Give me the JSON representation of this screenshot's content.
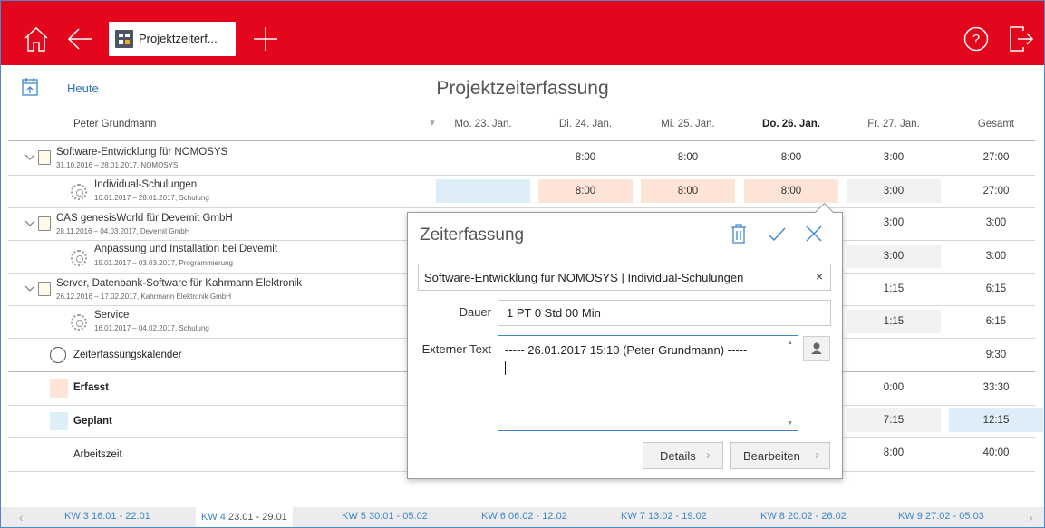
{
  "topbar": {
    "tab_label": "Projektzeiterf..."
  },
  "header": {
    "today_label": "Heute",
    "title": "Projektzeiterfassung",
    "person": "Peter Grundmann",
    "columns": [
      "Mo. 23. Jan.",
      "Di. 24. Jan.",
      "Mi. 25. Jan.",
      "Do. 26. Jan.",
      "Fr. 27. Jan.",
      "Gesamt"
    ]
  },
  "rows": [
    {
      "name": "Software-Entwicklung für NOMOSYS",
      "sub": "31.10.2016 – 28.01.2017, NOMOSYS",
      "values": [
        "",
        "8:00",
        "8:00",
        "8:00",
        "3:00",
        "27:00"
      ]
    },
    {
      "name": "Individual-Schulungen",
      "sub": "16.01.2017 – 28.01.2017, Schulung",
      "values": [
        "",
        "8:00",
        "8:00",
        "8:00",
        "3:00",
        "27:00"
      ]
    },
    {
      "name": "CAS genesisWorld für Devemit GmbH",
      "sub": "28.11.2016 – 04.03.2017, Devemit GmbH",
      "values": [
        "",
        "",
        "",
        "",
        "3:00",
        "3:00"
      ]
    },
    {
      "name": "Anpassung und Installation bei Devemit",
      "sub": "15.01.2017 – 03.03.2017, Programmierung",
      "values": [
        "",
        "",
        "",
        "",
        "3:00",
        "3:00"
      ]
    },
    {
      "name": "Server, Datenbank-Software für Kahrmann Elektronik",
      "sub": "26.12.2016 – 17.02.2017, Kahrmann Elektronik GmbH",
      "values": [
        "",
        "",
        "",
        "",
        "1:15",
        "6:15"
      ]
    },
    {
      "name": "Service",
      "sub": "16.01.2017 – 04.02.2017, Schulung",
      "values": [
        "",
        "",
        "",
        "",
        "1:15",
        "6:15"
      ]
    }
  ],
  "calendar_row": {
    "label": "Zeiterfassungskalender",
    "total": "9:30"
  },
  "summary": {
    "erfasst": {
      "label": "Erfasst",
      "fri": "0:00",
      "total": "33:30"
    },
    "geplant": {
      "label": "Geplant",
      "fri": "7:15",
      "total": "12:15"
    },
    "arbeitszeit": {
      "label": "Arbeitszeit",
      "fri": "8:00",
      "total": "40:00"
    }
  },
  "dialog": {
    "title": "Zeiterfassung",
    "project": "Software-Entwicklung für NOMOSYS | Individual-Schulungen",
    "dauer_label": "Dauer",
    "dauer_value": "1 PT 0 Std 00 Min",
    "text_label": "Externer Text",
    "text_value": "----- 26.01.2017 15:10 (Peter Grundmann) -----",
    "details_label": "Details",
    "edit_label": "Bearbeiten"
  },
  "weeks": [
    {
      "num": "KW 3",
      "range": "16.01 - 22.01"
    },
    {
      "num": "KW 4",
      "range": "23.01 - 29.01"
    },
    {
      "num": "KW 5",
      "range": "30.01 - 05.02"
    },
    {
      "num": "KW 6",
      "range": "06.02 - 12.02"
    },
    {
      "num": "KW 7",
      "range": "13.02 - 19.02"
    },
    {
      "num": "KW 8",
      "range": "20.02 - 26.02"
    },
    {
      "num": "KW 9",
      "range": "27.02 - 05.03"
    }
  ],
  "colors": {
    "brand": "#e3061c",
    "accent": "#3d87c9",
    "captured": "#fde4d6",
    "planned": "#ddeef9"
  }
}
